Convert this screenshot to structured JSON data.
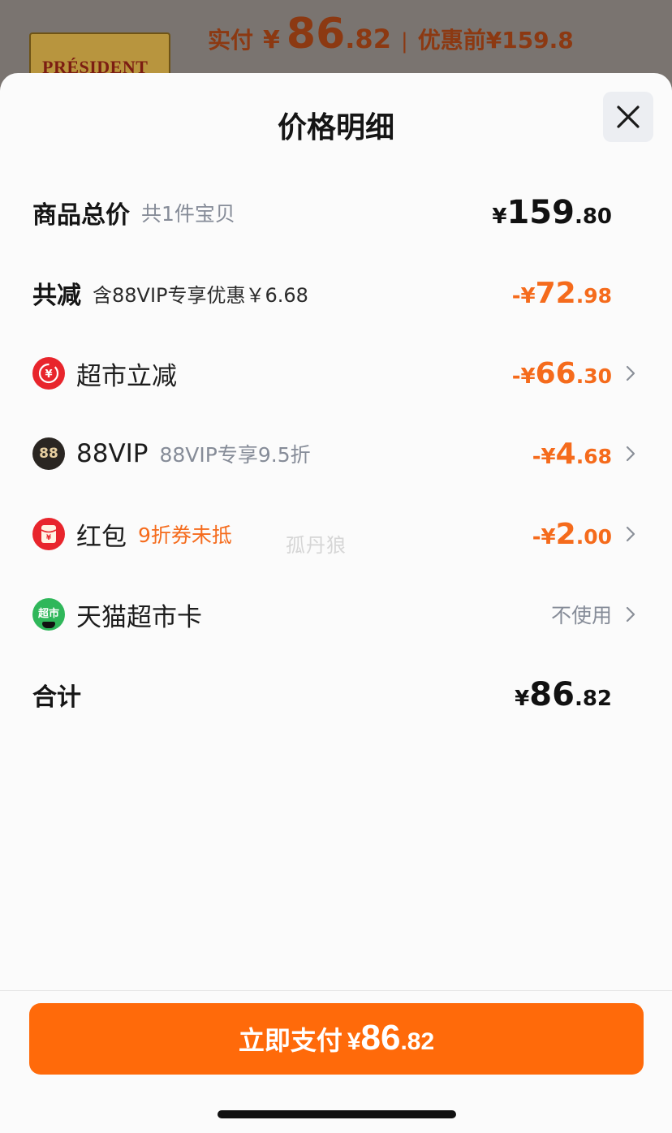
{
  "background": {
    "product_label": "PRÉSIDENT",
    "paid_label": "实付",
    "currency": "¥",
    "paid_int": "86",
    "paid_dec": ".82",
    "separator": "|",
    "original_label": "优惠前",
    "original_price": "¥159.8"
  },
  "sheet": {
    "title": "价格明细"
  },
  "rows": {
    "total": {
      "label": "商品总价",
      "sub": "共1件宝贝",
      "yen": "¥",
      "int": "159",
      "dec": ".80"
    },
    "discount_total": {
      "label": "共减",
      "sub": "含88VIP专享优惠￥6.68",
      "prefix": "-¥",
      "int": "72",
      "dec": ".98"
    },
    "market_discount": {
      "icon": "yen-refund-icon",
      "icon_text": "¥",
      "label": "超市立减",
      "prefix": "-¥",
      "int": "66",
      "dec": ".30"
    },
    "vip": {
      "icon": "88vip-icon",
      "icon_text": "88",
      "label": "88VIP",
      "sub": "88VIP专享9.5折",
      "prefix": "-¥",
      "int": "4",
      "dec": ".68"
    },
    "red_packet": {
      "icon": "red-packet-icon",
      "icon_text": "¥",
      "label": "红包",
      "sub": "9折券未抵",
      "prefix": "-¥",
      "int": "2",
      "dec": ".00"
    },
    "market_card": {
      "icon": "tmall-market-card-icon",
      "icon_text": "超市",
      "label": "天猫超市卡",
      "value": "不使用"
    },
    "sum": {
      "label": "合计",
      "yen": "¥",
      "int": "86",
      "dec": ".82"
    }
  },
  "watermark": "孤丹狼",
  "footer": {
    "pay_label": "立即支付",
    "yen": "¥",
    "int": "86",
    "dec": ".82"
  },
  "colors": {
    "accent_orange": "#f56b1c",
    "button_orange": "#ff6a0a",
    "icon_red": "#e8252c",
    "icon_green": "#2fb75a",
    "vip_dark": "#2a2622"
  }
}
